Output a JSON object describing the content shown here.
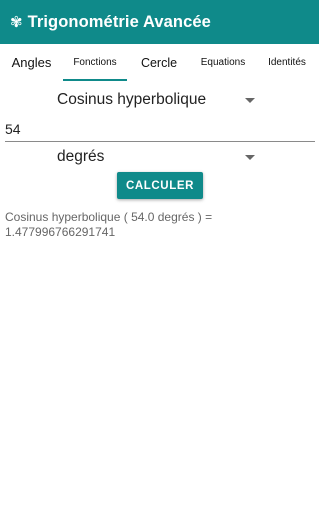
{
  "app": {
    "logo_glyph": "✾",
    "title": "Trigonométrie Avancée",
    "accent_color": "#0f8a8a"
  },
  "tabs": [
    {
      "label": "Angles",
      "active": false
    },
    {
      "label": "Fonctions",
      "active": true
    },
    {
      "label": "Cercle",
      "active": false
    },
    {
      "label": "Equations",
      "active": false
    },
    {
      "label": "Identités",
      "active": false
    }
  ],
  "form": {
    "function_select": {
      "value": "Cosinus hyperbolique",
      "icon": "dropdown-arrow-icon"
    },
    "input_value": "54",
    "unit_select": {
      "value": "degrés",
      "icon": "dropdown-arrow-icon"
    },
    "calculate_label": "CALCULER"
  },
  "result": {
    "line1": "Cosinus hyperbolique ( 54.0 degrés ) =",
    "line2": "1.477996766291741"
  }
}
